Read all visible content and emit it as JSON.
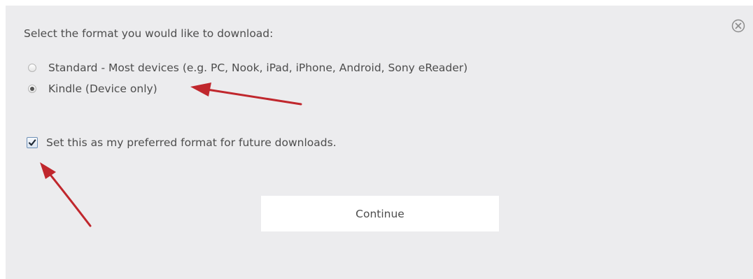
{
  "dialog": {
    "prompt": "Select the format you would like to download:",
    "options": [
      {
        "label": "Standard - Most devices (e.g. PC, Nook, iPad, iPhone, Android, Sony eReader)",
        "selected": false
      },
      {
        "label": "Kindle (Device only)",
        "selected": true
      }
    ],
    "preference": {
      "label": "Set this as my preferred format for future downloads.",
      "checked": true
    },
    "continue_label": "Continue",
    "close_icon": "close-circle-icon"
  },
  "annotations": {
    "arrow_color": "#c0272d",
    "arrows": [
      "arrow-to-kindle-option",
      "arrow-to-preference-checkbox"
    ]
  }
}
